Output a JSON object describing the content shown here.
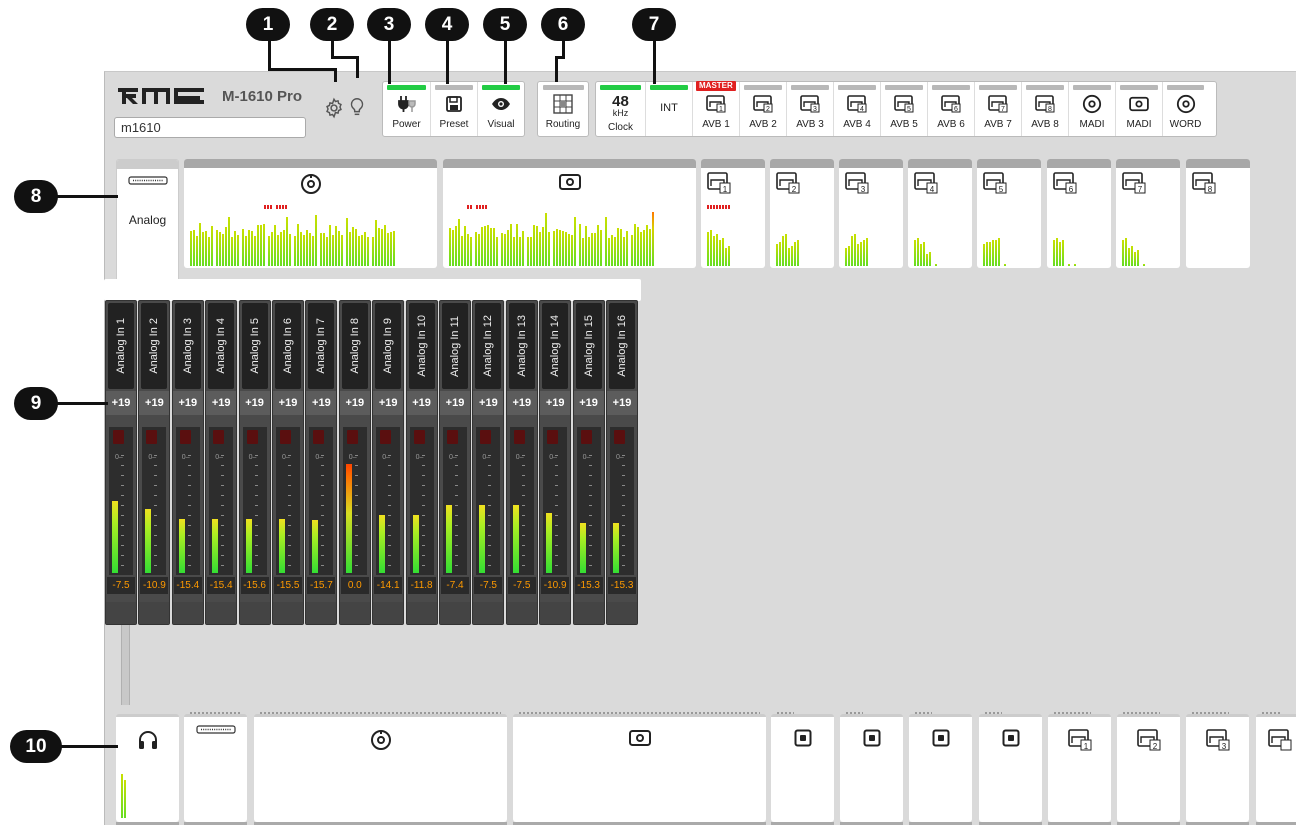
{
  "header": {
    "model": "M-1610 Pro",
    "device_name": "m1610",
    "settings_icon": "gear-icon",
    "identify_icon": "lightbulb-icon"
  },
  "callouts": [
    "1",
    "2",
    "3",
    "4",
    "5",
    "6",
    "7",
    "8",
    "9",
    "10"
  ],
  "toolbar": {
    "power_label": "Power",
    "preset_label": "Preset",
    "visual_label": "Visual",
    "routing_label": "Routing"
  },
  "sync": {
    "clock_value": "48",
    "clock_unit": "kHz",
    "clock_label": "Clock",
    "int_label": "INT",
    "master_badge": "MASTER",
    "sources": [
      "AVB 1",
      "AVB 2",
      "AVB 3",
      "AVB 4",
      "AVB 5",
      "AVB 6",
      "AVB 7",
      "AVB 8",
      "MADI",
      "MADI",
      "WORD"
    ]
  },
  "input_tabs": {
    "analog_label": "Analog",
    "avb_numbers": [
      "1",
      "2",
      "3",
      "4",
      "5",
      "6",
      "7",
      "8"
    ]
  },
  "channels": [
    {
      "name": "Analog In 1",
      "gain": "+19",
      "level": "-7.5",
      "fill": 0.6
    },
    {
      "name": "Analog In 2",
      "gain": "+19",
      "level": "-10.9",
      "fill": 0.53
    },
    {
      "name": "Analog In 3",
      "gain": "+19",
      "level": "-15.4",
      "fill": 0.45
    },
    {
      "name": "Analog In 4",
      "gain": "+19",
      "level": "-15.4",
      "fill": 0.45
    },
    {
      "name": "Analog In 5",
      "gain": "+19",
      "level": "-15.6",
      "fill": 0.45
    },
    {
      "name": "Analog In 6",
      "gain": "+19",
      "level": "-15.5",
      "fill": 0.45
    },
    {
      "name": "Analog In 7",
      "gain": "+19",
      "level": "-15.7",
      "fill": 0.44
    },
    {
      "name": "Analog In 8",
      "gain": "+19",
      "level": "0.0",
      "fill": 0.91
    },
    {
      "name": "Analog In 9",
      "gain": "+19",
      "level": "-14.1",
      "fill": 0.48
    },
    {
      "name": "Analog In 10",
      "gain": "+19",
      "level": "-11.8",
      "fill": 0.48
    },
    {
      "name": "Analog In 11",
      "gain": "+19",
      "level": "-7.4",
      "fill": 0.57
    },
    {
      "name": "Analog In 12",
      "gain": "+19",
      "level": "-7.5",
      "fill": 0.57
    },
    {
      "name": "Analog In 13",
      "gain": "+19",
      "level": "-7.5",
      "fill": 0.57
    },
    {
      "name": "Analog In 14",
      "gain": "+19",
      "level": "-10.9",
      "fill": 0.5
    },
    {
      "name": "Analog In 15",
      "gain": "+19",
      "level": "-15.3",
      "fill": 0.42
    },
    {
      "name": "Analog In 16",
      "gain": "+19",
      "level": "-15.3",
      "fill": 0.42
    }
  ],
  "output_tabs": {
    "avb_numbers": [
      "1",
      "2",
      "3"
    ]
  },
  "colors": {
    "active_bar": "#22cc44",
    "master_red": "#e02020",
    "level_text": "#ff9a00"
  }
}
